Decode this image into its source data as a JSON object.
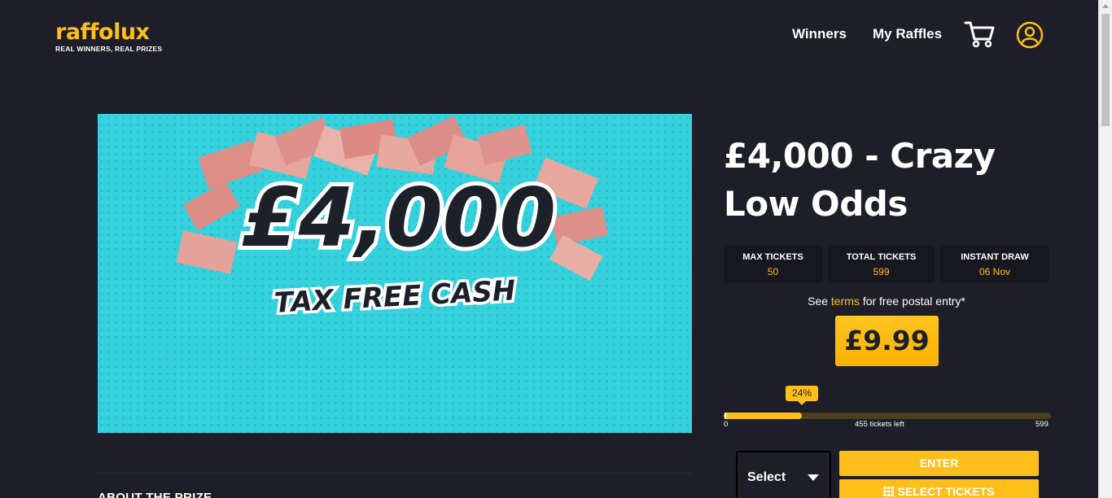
{
  "brand": {
    "name": "raffolux",
    "tagline": "REAL WINNERS, REAL PRIZES",
    "accent_color": "#ffbf1a"
  },
  "nav": {
    "winners": "Winners",
    "my_raffles": "My Raffles",
    "cart_icon": "cart-icon",
    "account_icon": "user-icon"
  },
  "hero": {
    "amount": "£4,000",
    "subtitle": "TAX FREE CASH",
    "background_color": "#35d2de"
  },
  "about_heading": "ABOUT THE PRIZE",
  "raffle": {
    "title": "£4,000 - Crazy Low Odds",
    "stats": [
      {
        "label": "MAX TICKETS",
        "value": "50"
      },
      {
        "label": "TOTAL TICKETS",
        "value": "599"
      },
      {
        "label": "INSTANT DRAW",
        "value": "06 Nov"
      }
    ],
    "terms_prefix": "See",
    "terms_link": "terms",
    "terms_suffix": "for free postal entry*",
    "price": "£9.99",
    "progress": {
      "percent_label": "24%",
      "fraction": 0.24,
      "min_label": "0",
      "max_label": "599",
      "left_label": "455 tickets left"
    },
    "select": {
      "label": "Select"
    },
    "enter_button": "ENTER",
    "select_tickets_button": "SELECT TICKETS"
  }
}
